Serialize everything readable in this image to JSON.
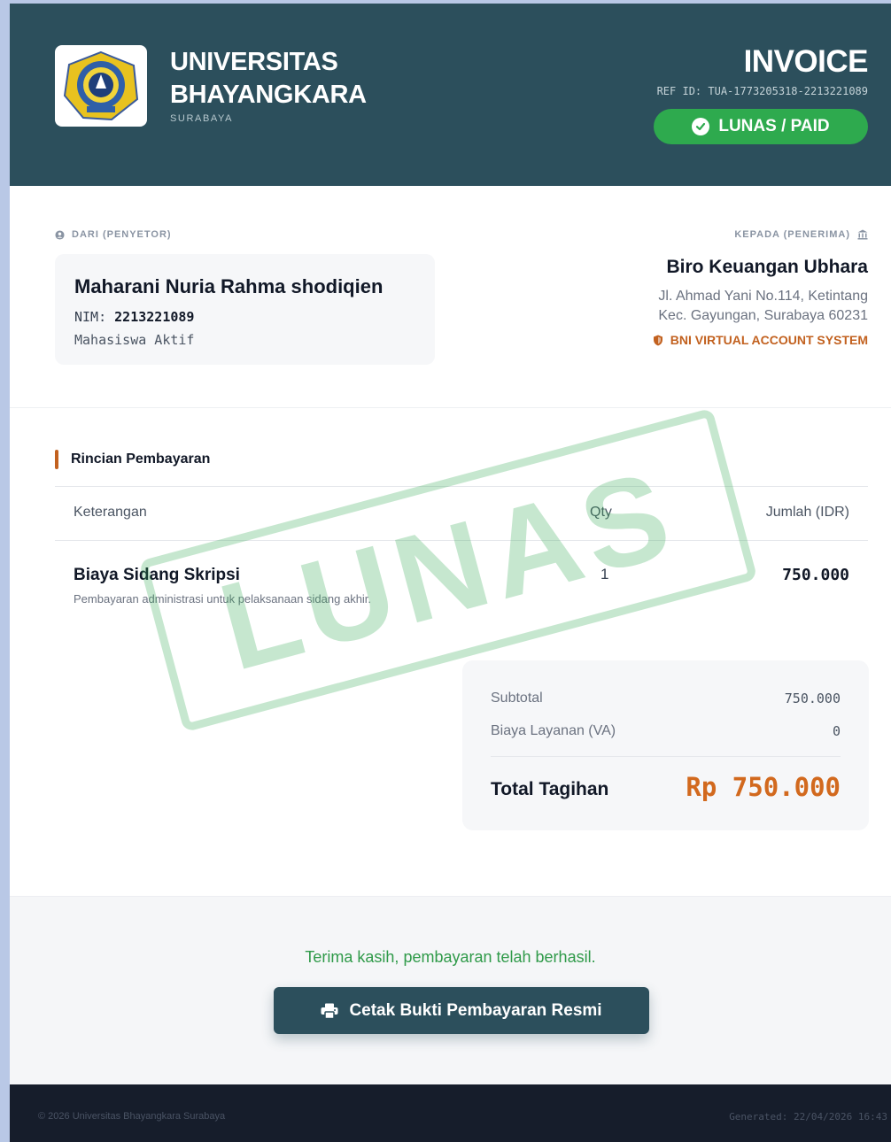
{
  "header": {
    "university_name_line1": "UNIVERSITAS",
    "university_name_line2": "BHAYANGKARA",
    "city": "SURABAYA",
    "document_title": "INVOICE",
    "ref_id": "REF ID: TUA-1773205318-2213221089",
    "status_badge": "LUNAS / PAID"
  },
  "from": {
    "label": "DARI (PENYETOR)",
    "name": "Maharani Nuria Rahma shodiqien",
    "nim_label": "NIM:",
    "nim": "2213221089",
    "status": "Mahasiswa Aktif"
  },
  "to": {
    "label": "KEPADA (PENERIMA)",
    "name": "Biro Keuangan Ubhara",
    "address_line1": "Jl. Ahmad Yani No.114, Ketintang",
    "address_line2": "Kec. Gayungan, Surabaya 60231",
    "system": "BNI VIRTUAL ACCOUNT SYSTEM"
  },
  "details": {
    "section_title": "Rincian Pembayaran",
    "columns": {
      "description": "Keterangan",
      "qty": "Qty",
      "amount": "Jumlah (IDR)"
    },
    "items": [
      {
        "name": "Biaya Sidang Skripsi",
        "description": "Pembayaran administrasi untuk pelaksanaan sidang akhir.",
        "qty": "1",
        "amount": "750.000"
      }
    ]
  },
  "stamp": {
    "text": "LUNAS"
  },
  "totals": {
    "subtotal_label": "Subtotal",
    "subtotal_value": "750.000",
    "fee_label": "Biaya Layanan (VA)",
    "fee_value": "0",
    "total_label": "Total Tagihan",
    "total_value": "Rp 750.000"
  },
  "footer": {
    "thanks": "Terima kasih, pembayaran telah berhasil.",
    "print_button": "Cetak Bukti Pembayaran Resmi",
    "copyright": "© 2026 Universitas Bhayangkara Surabaya",
    "generated": "Generated: 22/04/2026 16:43"
  },
  "colors": {
    "header_bg": "#2c4f5c",
    "paid_green": "#2eaa4e",
    "accent_orange": "#d2691e",
    "footer_dark": "#161d2b"
  },
  "icons": {
    "paid": "check-circle-icon",
    "from": "user-icon",
    "to": "bank-icon",
    "system": "shield-icon",
    "print": "printer-icon"
  }
}
